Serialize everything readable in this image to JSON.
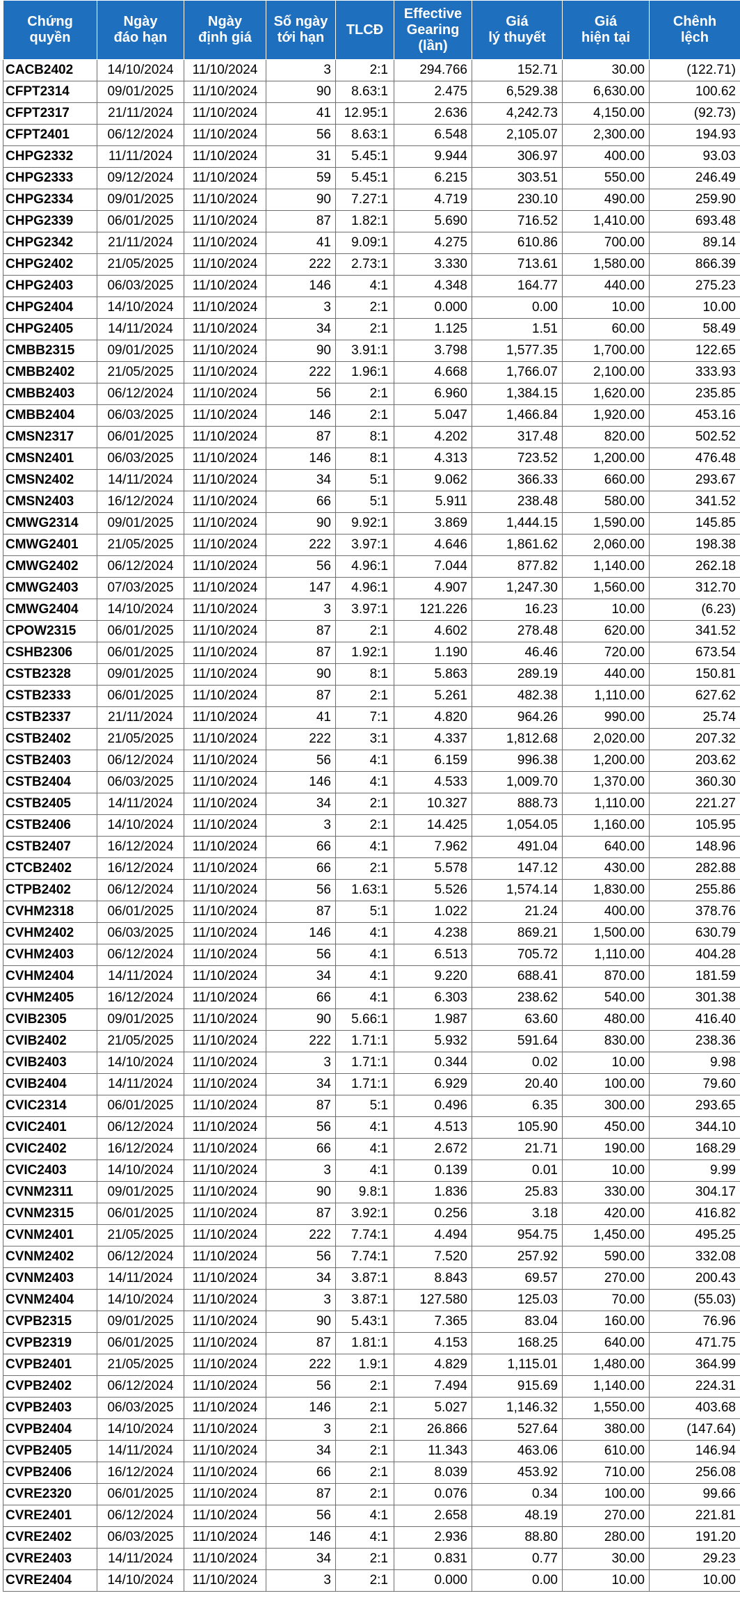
{
  "table": {
    "header_bg": "#1f6fbf",
    "headers": [
      "Chứng\nquyền",
      "Ngày\nđáo hạn",
      "Ngày\nđịnh giá",
      "Số ngày\ntới hạn",
      "TLCĐ",
      "Effective\nGearing\n(lần)",
      "Giá\nlý thuyết",
      "Giá\nhiện tại",
      "Chênh\nlệch"
    ],
    "rows": [
      [
        "CACB2402",
        "14/10/2024",
        "11/10/2024",
        "3",
        "2:1",
        "294.766",
        "152.71",
        "30.00",
        "(122.71)"
      ],
      [
        "CFPT2314",
        "09/01/2025",
        "11/10/2024",
        "90",
        "8.63:1",
        "2.475",
        "6,529.38",
        "6,630.00",
        "100.62"
      ],
      [
        "CFPT2317",
        "21/11/2024",
        "11/10/2024",
        "41",
        "12.95:1",
        "2.636",
        "4,242.73",
        "4,150.00",
        "(92.73)"
      ],
      [
        "CFPT2401",
        "06/12/2024",
        "11/10/2024",
        "56",
        "8.63:1",
        "6.548",
        "2,105.07",
        "2,300.00",
        "194.93"
      ],
      [
        "CHPG2332",
        "11/11/2024",
        "11/10/2024",
        "31",
        "5.45:1",
        "9.944",
        "306.97",
        "400.00",
        "93.03"
      ],
      [
        "CHPG2333",
        "09/12/2024",
        "11/10/2024",
        "59",
        "5.45:1",
        "6.215",
        "303.51",
        "550.00",
        "246.49"
      ],
      [
        "CHPG2334",
        "09/01/2025",
        "11/10/2024",
        "90",
        "7.27:1",
        "4.719",
        "230.10",
        "490.00",
        "259.90"
      ],
      [
        "CHPG2339",
        "06/01/2025",
        "11/10/2024",
        "87",
        "1.82:1",
        "5.690",
        "716.52",
        "1,410.00",
        "693.48"
      ],
      [
        "CHPG2342",
        "21/11/2024",
        "11/10/2024",
        "41",
        "9.09:1",
        "4.275",
        "610.86",
        "700.00",
        "89.14"
      ],
      [
        "CHPG2402",
        "21/05/2025",
        "11/10/2024",
        "222",
        "2.73:1",
        "3.330",
        "713.61",
        "1,580.00",
        "866.39"
      ],
      [
        "CHPG2403",
        "06/03/2025",
        "11/10/2024",
        "146",
        "4:1",
        "4.348",
        "164.77",
        "440.00",
        "275.23"
      ],
      [
        "CHPG2404",
        "14/10/2024",
        "11/10/2024",
        "3",
        "2:1",
        "0.000",
        "0.00",
        "10.00",
        "10.00"
      ],
      [
        "CHPG2405",
        "14/11/2024",
        "11/10/2024",
        "34",
        "2:1",
        "1.125",
        "1.51",
        "60.00",
        "58.49"
      ],
      [
        "CMBB2315",
        "09/01/2025",
        "11/10/2024",
        "90",
        "3.91:1",
        "3.798",
        "1,577.35",
        "1,700.00",
        "122.65"
      ],
      [
        "CMBB2402",
        "21/05/2025",
        "11/10/2024",
        "222",
        "1.96:1",
        "4.668",
        "1,766.07",
        "2,100.00",
        "333.93"
      ],
      [
        "CMBB2403",
        "06/12/2024",
        "11/10/2024",
        "56",
        "2:1",
        "6.960",
        "1,384.15",
        "1,620.00",
        "235.85"
      ],
      [
        "CMBB2404",
        "06/03/2025",
        "11/10/2024",
        "146",
        "2:1",
        "5.047",
        "1,466.84",
        "1,920.00",
        "453.16"
      ],
      [
        "CMSN2317",
        "06/01/2025",
        "11/10/2024",
        "87",
        "8:1",
        "4.202",
        "317.48",
        "820.00",
        "502.52"
      ],
      [
        "CMSN2401",
        "06/03/2025",
        "11/10/2024",
        "146",
        "8:1",
        "4.313",
        "723.52",
        "1,200.00",
        "476.48"
      ],
      [
        "CMSN2402",
        "14/11/2024",
        "11/10/2024",
        "34",
        "5:1",
        "9.062",
        "366.33",
        "660.00",
        "293.67"
      ],
      [
        "CMSN2403",
        "16/12/2024",
        "11/10/2024",
        "66",
        "5:1",
        "5.911",
        "238.48",
        "580.00",
        "341.52"
      ],
      [
        "CMWG2314",
        "09/01/2025",
        "11/10/2024",
        "90",
        "9.92:1",
        "3.869",
        "1,444.15",
        "1,590.00",
        "145.85"
      ],
      [
        "CMWG2401",
        "21/05/2025",
        "11/10/2024",
        "222",
        "3.97:1",
        "4.646",
        "1,861.62",
        "2,060.00",
        "198.38"
      ],
      [
        "CMWG2402",
        "06/12/2024",
        "11/10/2024",
        "56",
        "4.96:1",
        "7.044",
        "877.82",
        "1,140.00",
        "262.18"
      ],
      [
        "CMWG2403",
        "07/03/2025",
        "11/10/2024",
        "147",
        "4.96:1",
        "4.907",
        "1,247.30",
        "1,560.00",
        "312.70"
      ],
      [
        "CMWG2404",
        "14/10/2024",
        "11/10/2024",
        "3",
        "3.97:1",
        "121.226",
        "16.23",
        "10.00",
        "(6.23)"
      ],
      [
        "CPOW2315",
        "06/01/2025",
        "11/10/2024",
        "87",
        "2:1",
        "4.602",
        "278.48",
        "620.00",
        "341.52"
      ],
      [
        "CSHB2306",
        "06/01/2025",
        "11/10/2024",
        "87",
        "1.92:1",
        "1.190",
        "46.46",
        "720.00",
        "673.54"
      ],
      [
        "CSTB2328",
        "09/01/2025",
        "11/10/2024",
        "90",
        "8:1",
        "5.863",
        "289.19",
        "440.00",
        "150.81"
      ],
      [
        "CSTB2333",
        "06/01/2025",
        "11/10/2024",
        "87",
        "2:1",
        "5.261",
        "482.38",
        "1,110.00",
        "627.62"
      ],
      [
        "CSTB2337",
        "21/11/2024",
        "11/10/2024",
        "41",
        "7:1",
        "4.820",
        "964.26",
        "990.00",
        "25.74"
      ],
      [
        "CSTB2402",
        "21/05/2025",
        "11/10/2024",
        "222",
        "3:1",
        "4.337",
        "1,812.68",
        "2,020.00",
        "207.32"
      ],
      [
        "CSTB2403",
        "06/12/2024",
        "11/10/2024",
        "56",
        "4:1",
        "6.159",
        "996.38",
        "1,200.00",
        "203.62"
      ],
      [
        "CSTB2404",
        "06/03/2025",
        "11/10/2024",
        "146",
        "4:1",
        "4.533",
        "1,009.70",
        "1,370.00",
        "360.30"
      ],
      [
        "CSTB2405",
        "14/11/2024",
        "11/10/2024",
        "34",
        "2:1",
        "10.327",
        "888.73",
        "1,110.00",
        "221.27"
      ],
      [
        "CSTB2406",
        "14/10/2024",
        "11/10/2024",
        "3",
        "2:1",
        "14.425",
        "1,054.05",
        "1,160.00",
        "105.95"
      ],
      [
        "CSTB2407",
        "16/12/2024",
        "11/10/2024",
        "66",
        "4:1",
        "7.962",
        "491.04",
        "640.00",
        "148.96"
      ],
      [
        "CTCB2402",
        "16/12/2024",
        "11/10/2024",
        "66",
        "2:1",
        "5.578",
        "147.12",
        "430.00",
        "282.88"
      ],
      [
        "CTPB2402",
        "06/12/2024",
        "11/10/2024",
        "56",
        "1.63:1",
        "5.526",
        "1,574.14",
        "1,830.00",
        "255.86"
      ],
      [
        "CVHM2318",
        "06/01/2025",
        "11/10/2024",
        "87",
        "5:1",
        "1.022",
        "21.24",
        "400.00",
        "378.76"
      ],
      [
        "CVHM2402",
        "06/03/2025",
        "11/10/2024",
        "146",
        "4:1",
        "4.238",
        "869.21",
        "1,500.00",
        "630.79"
      ],
      [
        "CVHM2403",
        "06/12/2024",
        "11/10/2024",
        "56",
        "4:1",
        "6.513",
        "705.72",
        "1,110.00",
        "404.28"
      ],
      [
        "CVHM2404",
        "14/11/2024",
        "11/10/2024",
        "34",
        "4:1",
        "9.220",
        "688.41",
        "870.00",
        "181.59"
      ],
      [
        "CVHM2405",
        "16/12/2024",
        "11/10/2024",
        "66",
        "4:1",
        "6.303",
        "238.62",
        "540.00",
        "301.38"
      ],
      [
        "CVIB2305",
        "09/01/2025",
        "11/10/2024",
        "90",
        "5.66:1",
        "1.987",
        "63.60",
        "480.00",
        "416.40"
      ],
      [
        "CVIB2402",
        "21/05/2025",
        "11/10/2024",
        "222",
        "1.71:1",
        "5.932",
        "591.64",
        "830.00",
        "238.36"
      ],
      [
        "CVIB2403",
        "14/10/2024",
        "11/10/2024",
        "3",
        "1.71:1",
        "0.344",
        "0.02",
        "10.00",
        "9.98"
      ],
      [
        "CVIB2404",
        "14/11/2024",
        "11/10/2024",
        "34",
        "1.71:1",
        "6.929",
        "20.40",
        "100.00",
        "79.60"
      ],
      [
        "CVIC2314",
        "06/01/2025",
        "11/10/2024",
        "87",
        "5:1",
        "0.496",
        "6.35",
        "300.00",
        "293.65"
      ],
      [
        "CVIC2401",
        "06/12/2024",
        "11/10/2024",
        "56",
        "4:1",
        "4.513",
        "105.90",
        "450.00",
        "344.10"
      ],
      [
        "CVIC2402",
        "16/12/2024",
        "11/10/2024",
        "66",
        "4:1",
        "2.672",
        "21.71",
        "190.00",
        "168.29"
      ],
      [
        "CVIC2403",
        "14/10/2024",
        "11/10/2024",
        "3",
        "4:1",
        "0.139",
        "0.01",
        "10.00",
        "9.99"
      ],
      [
        "CVNM2311",
        "09/01/2025",
        "11/10/2024",
        "90",
        "9.8:1",
        "1.836",
        "25.83",
        "330.00",
        "304.17"
      ],
      [
        "CVNM2315",
        "06/01/2025",
        "11/10/2024",
        "87",
        "3.92:1",
        "0.256",
        "3.18",
        "420.00",
        "416.82"
      ],
      [
        "CVNM2401",
        "21/05/2025",
        "11/10/2024",
        "222",
        "7.74:1",
        "4.494",
        "954.75",
        "1,450.00",
        "495.25"
      ],
      [
        "CVNM2402",
        "06/12/2024",
        "11/10/2024",
        "56",
        "7.74:1",
        "7.520",
        "257.92",
        "590.00",
        "332.08"
      ],
      [
        "CVNM2403",
        "14/11/2024",
        "11/10/2024",
        "34",
        "3.87:1",
        "8.843",
        "69.57",
        "270.00",
        "200.43"
      ],
      [
        "CVNM2404",
        "14/10/2024",
        "11/10/2024",
        "3",
        "3.87:1",
        "127.580",
        "125.03",
        "70.00",
        "(55.03)"
      ],
      [
        "CVPB2315",
        "09/01/2025",
        "11/10/2024",
        "90",
        "5.43:1",
        "7.365",
        "83.04",
        "160.00",
        "76.96"
      ],
      [
        "CVPB2319",
        "06/01/2025",
        "11/10/2024",
        "87",
        "1.81:1",
        "4.153",
        "168.25",
        "640.00",
        "471.75"
      ],
      [
        "CVPB2401",
        "21/05/2025",
        "11/10/2024",
        "222",
        "1.9:1",
        "4.829",
        "1,115.01",
        "1,480.00",
        "364.99"
      ],
      [
        "CVPB2402",
        "06/12/2024",
        "11/10/2024",
        "56",
        "2:1",
        "7.494",
        "915.69",
        "1,140.00",
        "224.31"
      ],
      [
        "CVPB2403",
        "06/03/2025",
        "11/10/2024",
        "146",
        "2:1",
        "5.027",
        "1,146.32",
        "1,550.00",
        "403.68"
      ],
      [
        "CVPB2404",
        "14/10/2024",
        "11/10/2024",
        "3",
        "2:1",
        "26.866",
        "527.64",
        "380.00",
        "(147.64)"
      ],
      [
        "CVPB2405",
        "14/11/2024",
        "11/10/2024",
        "34",
        "2:1",
        "11.343",
        "463.06",
        "610.00",
        "146.94"
      ],
      [
        "CVPB2406",
        "16/12/2024",
        "11/10/2024",
        "66",
        "2:1",
        "8.039",
        "453.92",
        "710.00",
        "256.08"
      ],
      [
        "CVRE2320",
        "06/01/2025",
        "11/10/2024",
        "87",
        "2:1",
        "0.076",
        "0.34",
        "100.00",
        "99.66"
      ],
      [
        "CVRE2401",
        "06/12/2024",
        "11/10/2024",
        "56",
        "4:1",
        "2.658",
        "48.19",
        "270.00",
        "221.81"
      ],
      [
        "CVRE2402",
        "06/03/2025",
        "11/10/2024",
        "146",
        "4:1",
        "2.936",
        "88.80",
        "280.00",
        "191.20"
      ],
      [
        "CVRE2403",
        "14/11/2024",
        "11/10/2024",
        "34",
        "2:1",
        "0.831",
        "0.77",
        "30.00",
        "29.23"
      ],
      [
        "CVRE2404",
        "14/10/2024",
        "11/10/2024",
        "3",
        "2:1",
        "0.000",
        "0.00",
        "10.00",
        "10.00"
      ]
    ]
  }
}
